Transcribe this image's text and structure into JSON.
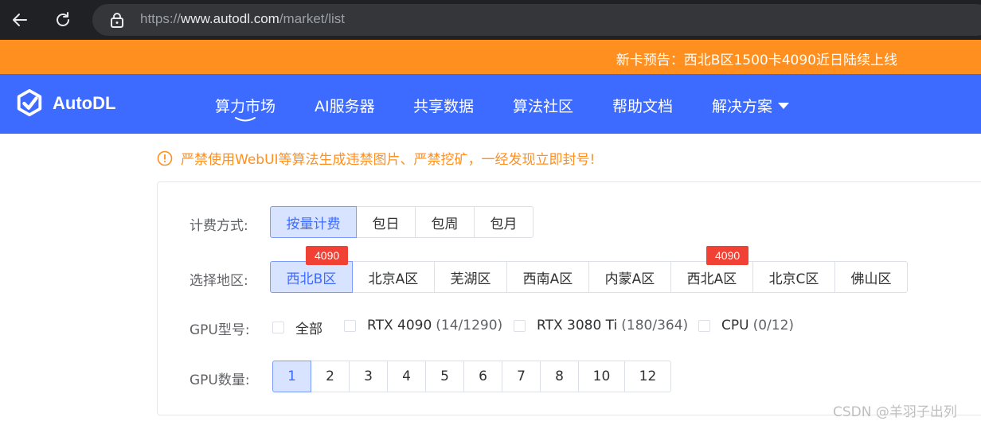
{
  "browser": {
    "url_scheme": "https://",
    "url_host": "www.autodl.com",
    "url_path": "/market/list"
  },
  "notice": {
    "text": "新卡预告：西北B区1500卡4090近日陆续上线"
  },
  "nav": {
    "brand": "AutoDL",
    "items": [
      {
        "label": "算力市场",
        "active": true
      },
      {
        "label": "AI服务器"
      },
      {
        "label": "共享数据"
      },
      {
        "label": "算法社区"
      },
      {
        "label": "帮助文档"
      },
      {
        "label": "解决方案"
      }
    ]
  },
  "warning": {
    "text": "严禁使用WebUI等算法生成违禁图片、严禁挖矿，一经发现立即封号!"
  },
  "filters": {
    "billing": {
      "label": "计费方式:",
      "options": [
        "按量计费",
        "包日",
        "包周",
        "包月"
      ],
      "selected": "按量计费"
    },
    "region": {
      "label": "选择地区:",
      "options": [
        "西北B区",
        "北京A区",
        "芜湖区",
        "西南A区",
        "内蒙A区",
        "西北A区",
        "北京C区",
        "佛山区"
      ],
      "selected": "西北B区",
      "badges": [
        {
          "region": "西北B区",
          "text": "4090"
        },
        {
          "region": "西北A区",
          "text": "4090"
        }
      ]
    },
    "gpu_model": {
      "label": "GPU型号:",
      "options": [
        {
          "name": "全部",
          "count": ""
        },
        {
          "name": "RTX 4090",
          "count": "(14/1290)"
        },
        {
          "name": "RTX 3080 Ti",
          "count": "(180/364)"
        },
        {
          "name": "CPU",
          "count": "(0/12)"
        }
      ]
    },
    "gpu_count": {
      "label": "GPU数量:",
      "options": [
        "1",
        "2",
        "3",
        "4",
        "5",
        "6",
        "7",
        "8",
        "10",
        "12"
      ],
      "selected": "1"
    }
  },
  "watermark": {
    "text": "CSDN @羊羽子出列"
  },
  "colors": {
    "brand_blue": "#3e6bff",
    "notice_orange": "#ff8f1f",
    "badge_red": "#f04134"
  }
}
